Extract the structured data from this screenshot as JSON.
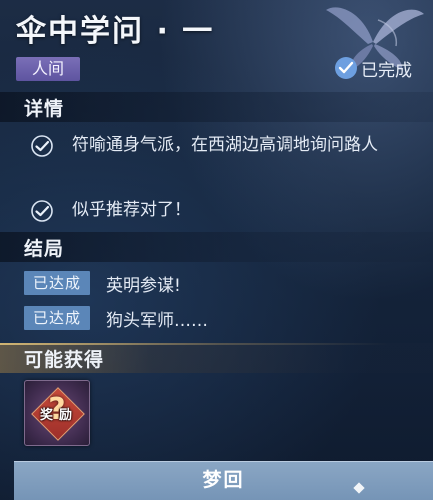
{
  "quest": {
    "title": "伞中学问 · 一",
    "category": "人间",
    "status": "已完成"
  },
  "details": {
    "heading": "详情",
    "items": [
      {
        "text": "符喻通身气派，在西湖边高调地询问路人",
        "checked": true
      },
      {
        "text": "似乎推荐对了！",
        "checked": true
      }
    ]
  },
  "endings": {
    "heading": "结局",
    "items": [
      {
        "badge": "已达成",
        "text": "英明参谋!"
      },
      {
        "badge": "已达成",
        "text": "狗头军师……"
      }
    ]
  },
  "rewards": {
    "heading": "可能获得",
    "items": [
      {
        "icon": "mystery-reward-icon",
        "label": "奖励",
        "symbol": "?"
      }
    ]
  },
  "action": {
    "label": "梦回"
  },
  "colors": {
    "category_tag": "#6b61ac",
    "status_check": "#6d9fe0",
    "ending_badge": "#5b86b8",
    "button": "#7d9bbc",
    "reward_accent": "#c9a86a"
  }
}
